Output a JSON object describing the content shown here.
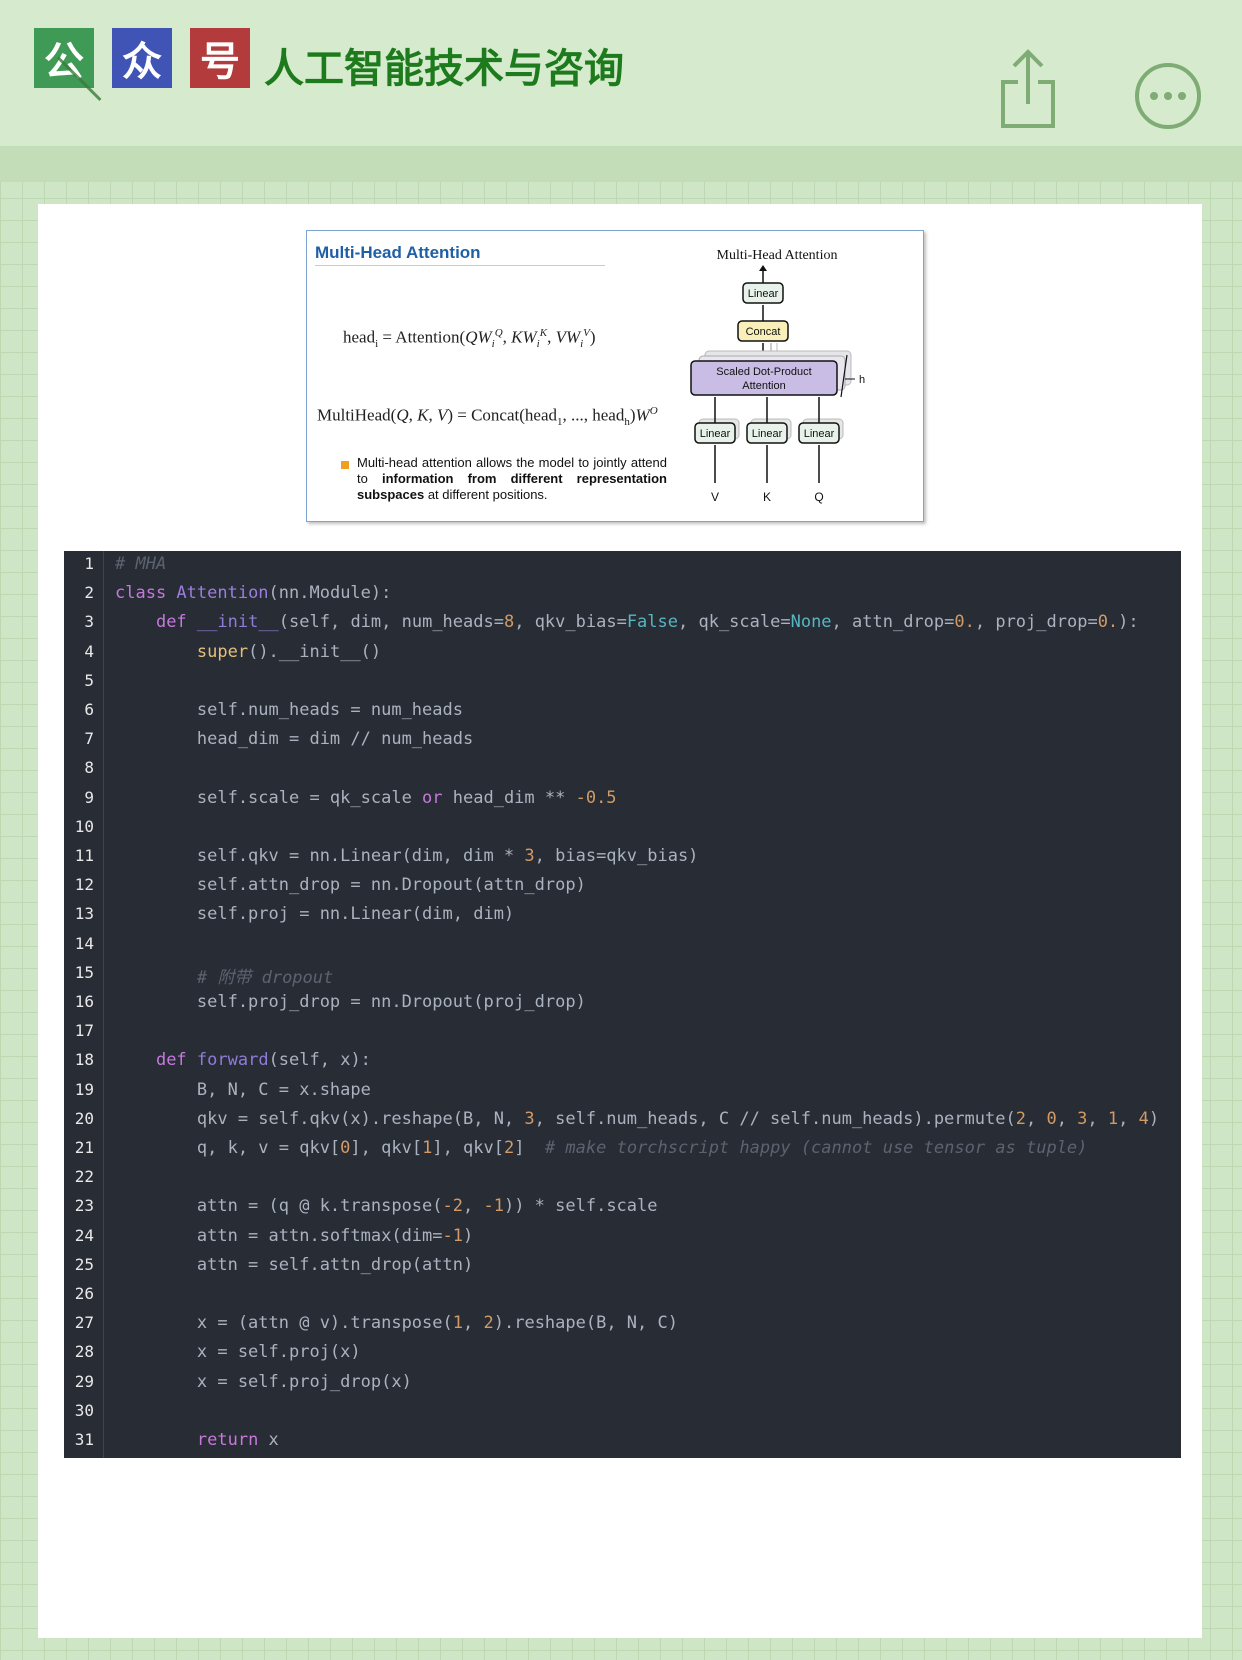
{
  "header": {
    "badges": [
      "公",
      "众",
      "号"
    ],
    "account_name": "人工智能技术与咨询",
    "share_icon": "share-icon",
    "more_icon": "more-icon"
  },
  "slide": {
    "title": "Multi-Head Attention",
    "formula_head": "head_i = Attention(QW_i^Q, KW_i^K, VW_i^V)",
    "formula_multi": "MultiHead(Q, K, V) = Concat(head_1, ..., head_h)W^O",
    "bullet_part1": "Multi-head attention allows the model to jointly attend to ",
    "bullet_bold1": "information from different representation subspaces",
    "bullet_part2": " at different positions.",
    "diagram": {
      "title": "Multi-Head Attention",
      "linear_top": "Linear",
      "concat": "Concat",
      "sdpa_line1": "Scaled Dot-Product",
      "sdpa_line2": "Attention",
      "h_label": "h",
      "linear_v": "Linear",
      "linear_k": "Linear",
      "linear_q": "Linear",
      "input_v": "V",
      "input_k": "K",
      "input_q": "Q"
    }
  },
  "code": {
    "line_numbers": [
      "1",
      "2",
      "3",
      "4",
      "5",
      "6",
      "7",
      "8",
      "9",
      "10",
      "11",
      "12",
      "13",
      "14",
      "15",
      "16",
      "17",
      "18",
      "19",
      "20",
      "21",
      "22",
      "23",
      "24",
      "25",
      "26",
      "27",
      "28",
      "29",
      "30",
      "31"
    ],
    "lines": [
      [
        [
          "cm",
          "# MHA"
        ]
      ],
      [
        [
          "k",
          "class "
        ],
        [
          "cl",
          "Attention"
        ],
        [
          "p",
          "(nn.Module):"
        ]
      ],
      [
        [
          "p",
          "    "
        ],
        [
          "k",
          "def "
        ],
        [
          "fn",
          "__init__"
        ],
        [
          "p",
          "(self, dim, num_heads="
        ],
        [
          "nm",
          "8"
        ],
        [
          "p",
          ", qkv_bias="
        ],
        [
          "bt",
          "False"
        ],
        [
          "p",
          ", qk_scale="
        ],
        [
          "bt",
          "None"
        ],
        [
          "p",
          ", attn_drop="
        ],
        [
          "nm",
          "0."
        ],
        [
          "p",
          ", proj_drop="
        ],
        [
          "nm",
          "0."
        ],
        [
          "p",
          "):"
        ]
      ],
      [
        [
          "p",
          "        "
        ],
        [
          "sp",
          "super"
        ],
        [
          "p",
          "().__init__()"
        ]
      ],
      [],
      [
        [
          "p",
          "        self.num_heads = num_heads"
        ]
      ],
      [
        [
          "p",
          "        head_dim = dim // num_heads"
        ]
      ],
      [],
      [
        [
          "p",
          "        self.scale = qk_scale "
        ],
        [
          "k",
          "or"
        ],
        [
          "p",
          " head_dim ** "
        ],
        [
          "nm",
          "-0.5"
        ]
      ],
      [],
      [
        [
          "p",
          "        self.qkv = nn.Linear(dim, dim * "
        ],
        [
          "nm",
          "3"
        ],
        [
          "p",
          ", bias=qkv_bias)"
        ]
      ],
      [
        [
          "p",
          "        self.attn_drop = nn.Dropout(attn_drop)"
        ]
      ],
      [
        [
          "p",
          "        self.proj = nn.Linear(dim, dim)"
        ]
      ],
      [],
      [
        [
          "p",
          "        "
        ],
        [
          "cm",
          "# 附带 dropout"
        ]
      ],
      [
        [
          "p",
          "        self.proj_drop = nn.Dropout(proj_drop)"
        ]
      ],
      [],
      [
        [
          "p",
          "    "
        ],
        [
          "k",
          "def "
        ],
        [
          "fn",
          "forward"
        ],
        [
          "p",
          "(self, x):"
        ]
      ],
      [
        [
          "p",
          "        B, N, C = x.shape"
        ]
      ],
      [
        [
          "p",
          "        qkv = self.qkv(x).reshape(B, N, "
        ],
        [
          "nm",
          "3"
        ],
        [
          "p",
          ", self.num_heads, C // self.num_heads).permute("
        ],
        [
          "nm",
          "2"
        ],
        [
          "p",
          ", "
        ],
        [
          "nm",
          "0"
        ],
        [
          "p",
          ", "
        ],
        [
          "nm",
          "3"
        ],
        [
          "p",
          ", "
        ],
        [
          "nm",
          "1"
        ],
        [
          "p",
          ", "
        ],
        [
          "nm",
          "4"
        ],
        [
          "p",
          ")"
        ]
      ],
      [
        [
          "p",
          "        q, k, v = qkv["
        ],
        [
          "nm",
          "0"
        ],
        [
          "p",
          "], qkv["
        ],
        [
          "nm",
          "1"
        ],
        [
          "p",
          "], qkv["
        ],
        [
          "nm",
          "2"
        ],
        [
          "p",
          "]  "
        ],
        [
          "cm",
          "# make torchscript happy (cannot use tensor as tuple)"
        ]
      ],
      [],
      [
        [
          "p",
          "        attn = (q @ k.transpose("
        ],
        [
          "nm",
          "-2"
        ],
        [
          "p",
          ", "
        ],
        [
          "nm",
          "-1"
        ],
        [
          "p",
          ")) * self.scale"
        ]
      ],
      [
        [
          "p",
          "        attn = attn.softmax(dim="
        ],
        [
          "nm",
          "-1"
        ],
        [
          "p",
          ")"
        ]
      ],
      [
        [
          "p",
          "        attn = self.attn_drop(attn)"
        ]
      ],
      [],
      [
        [
          "p",
          "        x = (attn @ v).transpose("
        ],
        [
          "nm",
          "1"
        ],
        [
          "p",
          ", "
        ],
        [
          "nm",
          "2"
        ],
        [
          "p",
          ").reshape(B, N, C)"
        ]
      ],
      [
        [
          "p",
          "        x = self.proj(x)"
        ]
      ],
      [
        [
          "p",
          "        x = self.proj_drop(x)"
        ]
      ],
      [],
      [
        [
          "p",
          "        "
        ],
        [
          "k",
          "return"
        ],
        [
          "p",
          " x"
        ]
      ]
    ]
  }
}
